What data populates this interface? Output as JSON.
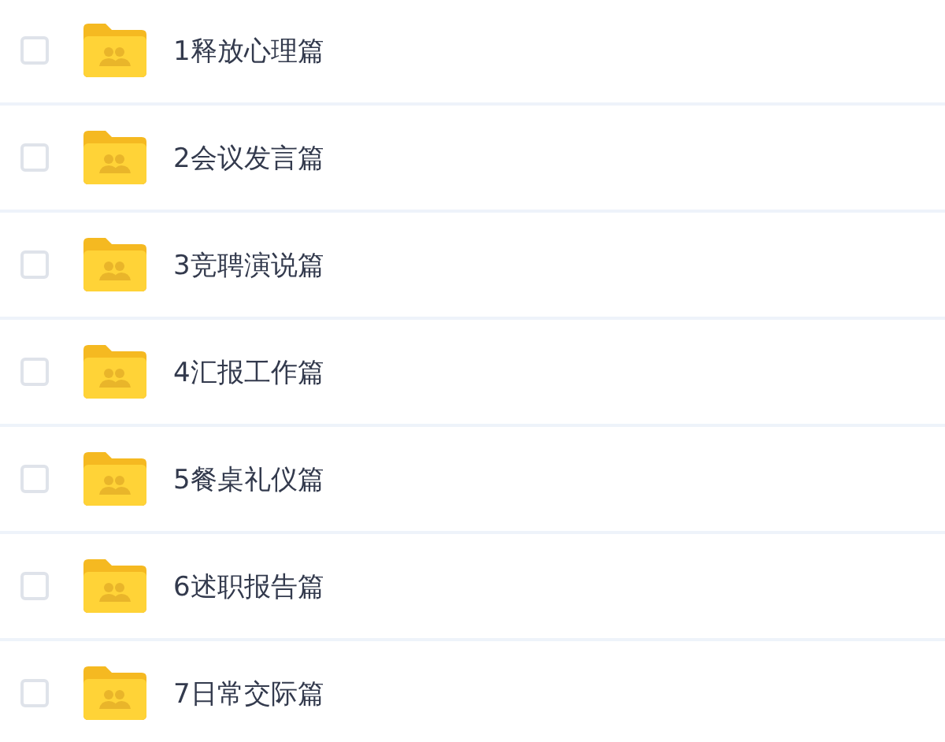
{
  "folders": [
    {
      "name": "1释放心理篇",
      "checked": false
    },
    {
      "name": "2会议发言篇",
      "checked": false
    },
    {
      "name": "3竞聘演说篇",
      "checked": false
    },
    {
      "name": "4汇报工作篇",
      "checked": false
    },
    {
      "name": "5餐桌礼仪篇",
      "checked": false
    },
    {
      "name": "6述职报告篇",
      "checked": false
    },
    {
      "name": "7日常交际篇",
      "checked": false
    }
  ]
}
